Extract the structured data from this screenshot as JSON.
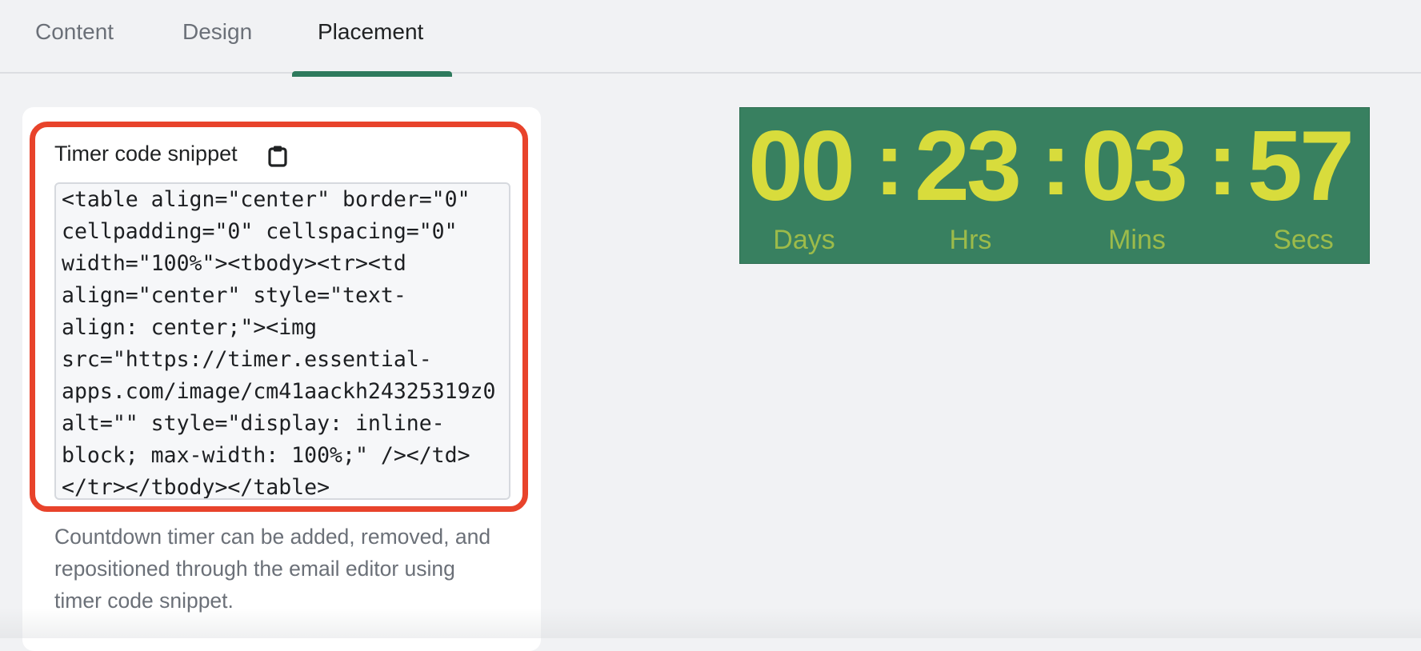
{
  "tabs": [
    {
      "label": "Content",
      "active": false
    },
    {
      "label": "Design",
      "active": false
    },
    {
      "label": "Placement",
      "active": true
    }
  ],
  "colors": {
    "accent": "#2e7a5d",
    "highlight_border": "#e8432b",
    "timer_background": "#388060",
    "timer_digits": "#d8dc3c",
    "timer_units": "#9cbb4a"
  },
  "snippet": {
    "label": "Timer code snippet",
    "copy_icon": "clipboard-icon",
    "code": "<table align=\"center\" border=\"0\"\ncellpadding=\"0\" cellspacing=\"0\"\nwidth=\"100%\"><tbody><tr><td\nalign=\"center\" style=\"text-\nalign: center;\"><img\nsrc=\"https://timer.essential-\napps.com/image/cm41aackh24325319z0\nalt=\"\" style=\"display: inline-\nblock; max-width: 100%;\" /></td>\n</tr></tbody></table>",
    "help_text": "Countdown timer can be added, removed, and repositioned through the email editor using timer code snippet."
  },
  "timer": {
    "days": "00",
    "hours": "23",
    "minutes": "03",
    "seconds": "57",
    "separator": ":",
    "labels": {
      "days": "Days",
      "hours": "Hrs",
      "minutes": "Mins",
      "seconds": "Secs"
    }
  }
}
